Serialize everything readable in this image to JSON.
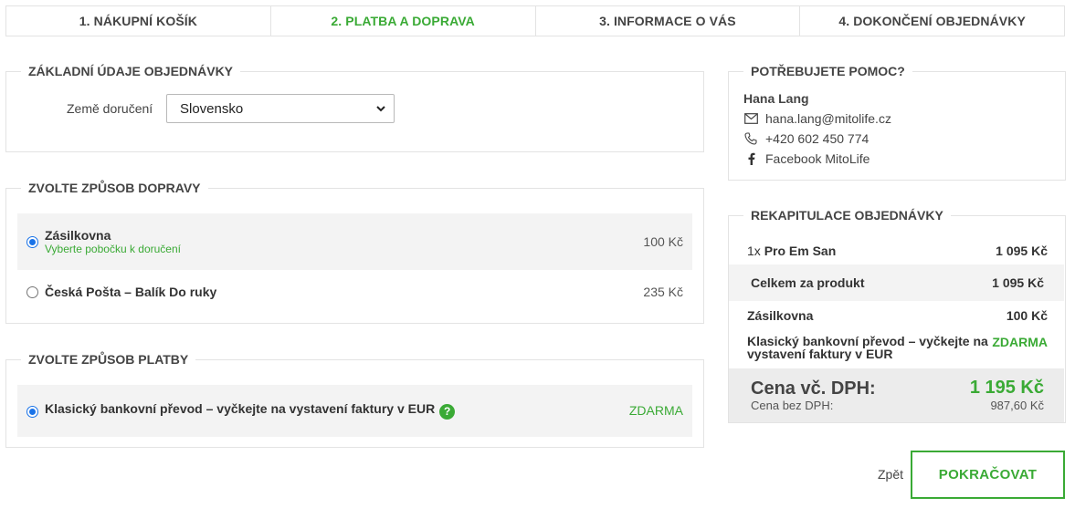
{
  "steps": [
    {
      "label": "1. NÁKUPNÍ KOŠÍK"
    },
    {
      "label": "2. PLATBA A DOPRAVA"
    },
    {
      "label": "3. INFORMACE O VÁS"
    },
    {
      "label": "4. DOKONČENÍ OBJEDNÁVKY"
    }
  ],
  "active_step": 2,
  "colors": {
    "accent": "#3aaa35",
    "radio": "#1a73e8",
    "shaded": "#f3f3f3"
  },
  "basic": {
    "legend": "ZÁKLADNÍ ÚDAJE OBJEDNÁVKY",
    "country_label": "Země doručení",
    "country_value": "Slovensko"
  },
  "shipping": {
    "legend": "ZVOLTE ZPŮSOB DOPRAVY",
    "options": [
      {
        "name": "Zásilkovna",
        "sub": "Vyberte pobočku k doručení",
        "price": "100 Kč",
        "selected": true
      },
      {
        "name": "Česká Pošta – Balík Do ruky",
        "price": "235 Kč",
        "selected": false
      }
    ]
  },
  "payment": {
    "legend": "ZVOLTE ZPŮSOB PLATBY",
    "options": [
      {
        "name": "Klasický bankovní převod – vyčkejte na vystavení faktury v EUR",
        "help_glyph": "?",
        "price": "ZDARMA",
        "selected": true
      }
    ]
  },
  "help": {
    "legend": "POTŘEBUJETE POMOC?",
    "name": "Hana Lang",
    "email": "hana.lang@mitolife.cz",
    "phone": "+420 602 450 774",
    "facebook": "Facebook MitoLife",
    "icons": [
      "mail-icon",
      "phone-icon",
      "facebook-icon"
    ]
  },
  "recap": {
    "legend": "REKAPITULACE OBJEDNÁVKY",
    "item_qty": "1x",
    "item_name": "Pro Em San",
    "item_price": "1 095 Kč",
    "subtotal_label": "Celkem za produkt",
    "subtotal_value": "1 095 Kč",
    "shipping_label": "Zásilkovna",
    "shipping_value": "100 Kč",
    "payment_label_line1": "Klasický bankovní převod – vyčkejte na",
    "payment_label_line2": "vystavení faktury v EUR",
    "payment_value": "ZDARMA",
    "total_label": "Cena vč. DPH:",
    "total_value": "1 195 Kč",
    "net_label": "Cena bez DPH:",
    "net_value": "987,60 Kč"
  },
  "nav": {
    "back_label": "Zpět",
    "continue_label": "POKRAČOVAT"
  }
}
